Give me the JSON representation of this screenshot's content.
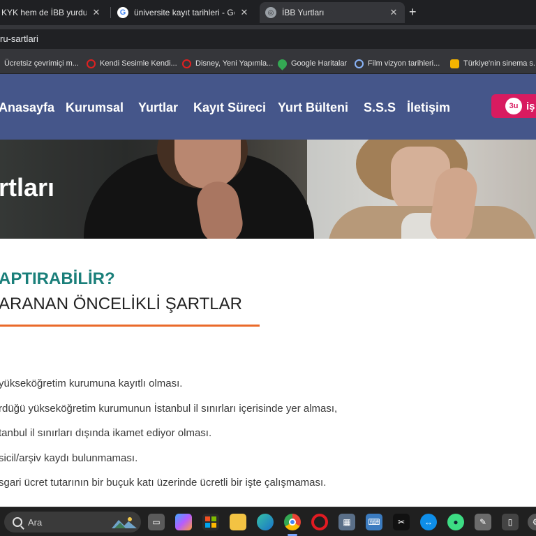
{
  "browser": {
    "tabs": [
      {
        "title": "KYK hem de İBB yurdu başvurusu",
        "active": false
      },
      {
        "title": "üniversite kayıt tarihleri - Google Ara",
        "active": false
      },
      {
        "title": "İBB Yurtları",
        "active": true
      }
    ],
    "address": "ru-sartlari",
    "bookmarks": [
      {
        "label": "Ücretsiz çevrimiçi m...",
        "icon": "opera-icon"
      },
      {
        "label": "Kendi Sesimle Kendi...",
        "icon": "opera-icon"
      },
      {
        "label": "Disney, Yeni Yapımla...",
        "icon": "opera-icon"
      },
      {
        "label": "Google Haritalar",
        "icon": "maps-pin-icon"
      },
      {
        "label": "Film vizyon tarihleri...",
        "icon": "play-circle-icon"
      },
      {
        "label": "Türkiye'nin sinema s...",
        "icon": "popcorn-icon"
      }
    ]
  },
  "site": {
    "nav": [
      "Anasayfa",
      "Kurumsal",
      "Yurtlar",
      "Kayıt Süreci",
      "Yurt Bülteni",
      "S.S.S",
      "İletişim"
    ],
    "nav_button_logo": "3u",
    "nav_button_label": "iş",
    "hero_title": "rtları",
    "subtitle_teal": "APTIRABİLİR?",
    "subtitle_dark": "ARANAN ÖNCELİKLİ ŞARTLAR",
    "requirements": [
      "yükseköğretim kurumuna kayıtlı olması.",
      "rdüğü yükseköğretim kurumunun İstanbul il sınırları içerisinde yer alması,",
      "tanbul il sınırları dışında ikamet ediyor olması.",
      "sicil/arşiv kaydı bulunmaması.",
      "sgari ücret tutarının bir buçuk katı üzerinde ücretli bir işte çalışmaması."
    ]
  },
  "taskbar": {
    "search_placeholder": "Ara",
    "apps": [
      "task-view-icon",
      "copilot-icon",
      "store-icon",
      "file-explorer-icon",
      "edge-icon",
      "chrome-icon",
      "opera-icon",
      "calculator-icon",
      "keyboard-app-icon",
      "capcut-icon",
      "teamviewer-icon",
      "android-app-icon",
      "snipping-tool-icon",
      "usb-drive-icon",
      "settings-icon"
    ]
  },
  "colors": {
    "navbar": "#45568a",
    "teal": "#1a7f7a",
    "orange_rule": "#ea6a2a",
    "nav_button": "#d81b60"
  }
}
